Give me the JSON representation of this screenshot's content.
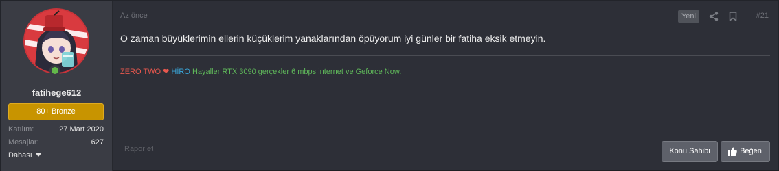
{
  "user": {
    "name": "fatihege612",
    "rank": "80+ Bronze",
    "stats": [
      {
        "label": "Katılım:",
        "value": "27 Mart 2020"
      },
      {
        "label": "Mesajlar:",
        "value": "627"
      }
    ],
    "more_label": "Dahası",
    "avatar_icon": "avatar-anime-girl",
    "online_status_icon": "online-user-icon"
  },
  "post": {
    "time": "Az önce",
    "new_badge": "Yeni",
    "number": "#21",
    "message": "O zaman büyüklerimin ellerin küçüklerim yanaklarından öpüyorum iyi günler bir fatiha eksik etmeyin.",
    "signature": {
      "zero_two": "ZERO TWO",
      "heart": "❤",
      "hiro": "HİRO",
      "rest": "Hayaller RTX 3090 gerçekler 6 mbps internet ve Geforce Now."
    }
  },
  "actions": {
    "report": "Rapor et",
    "owner": "Konu Sahibi",
    "like": "Beğen"
  },
  "colors": {
    "rank_bronze": "#c89400",
    "signature_red": "#e8584e",
    "signature_blue": "#3aa6d9",
    "signature_green": "#5fb85a",
    "online_green": "#63b84a"
  }
}
